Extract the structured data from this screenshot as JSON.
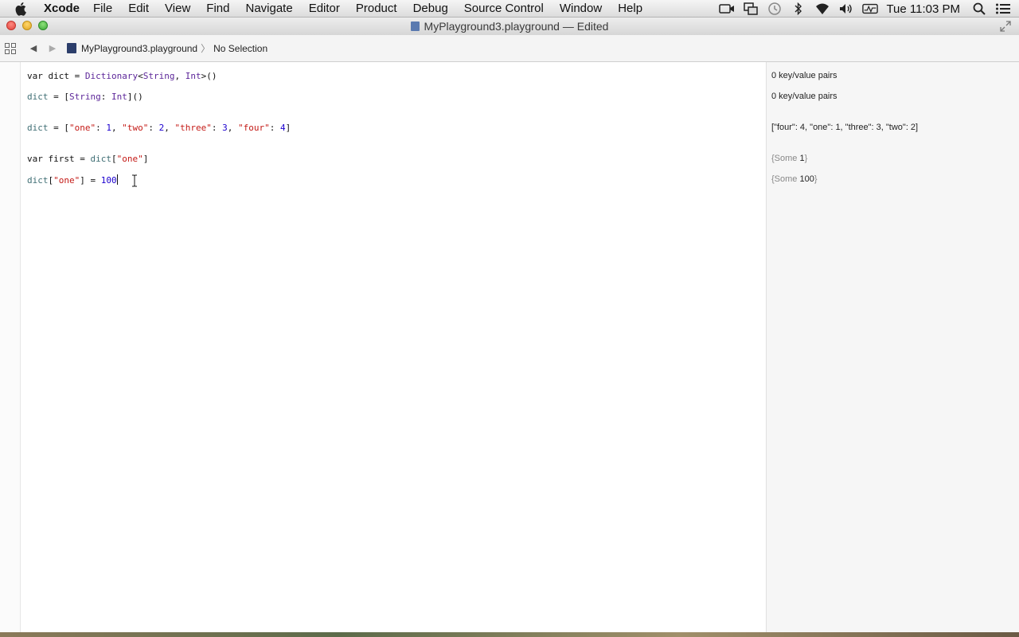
{
  "menubar": {
    "app_name": "Xcode",
    "items": [
      "File",
      "Edit",
      "View",
      "Find",
      "Navigate",
      "Editor",
      "Product",
      "Debug",
      "Source Control",
      "Window",
      "Help"
    ],
    "clock": "Tue 11:03 PM",
    "status_icons": [
      "facetime-camera-icon",
      "mirroring-icon",
      "time-machine-icon",
      "bluetooth-icon",
      "wifi-icon",
      "volume-icon",
      "activity-icon",
      "spotlight-icon",
      "notification-center-icon"
    ]
  },
  "window": {
    "title": "MyPlayground3.playground — Edited"
  },
  "jumpbar": {
    "file": "MyPlayground3.playground",
    "selection": "No Selection"
  },
  "code": {
    "line1": {
      "kw": "var",
      "name": " dict = ",
      "type1": "Dictionary",
      "lt": "<",
      "type2": "String",
      "comma": ", ",
      "type3": "Int",
      "end": ">()"
    },
    "line2": {
      "name": "dict",
      "eq": " = [",
      "type1": "String",
      "colon": ": ",
      "type2": "Int",
      "end": "]()"
    },
    "line3": {
      "name": "dict",
      "eq": " = [",
      "s1": "\"one\"",
      "c1": ": ",
      "n1": "1",
      "sep1": ", ",
      "s2": "\"two\"",
      "c2": ": ",
      "n2": "2",
      "sep2": ", ",
      "s3": "\"three\"",
      "c3": ": ",
      "n3": "3",
      "sep3": ", ",
      "s4": "\"four\"",
      "c4": ": ",
      "n4": "4",
      "end": "]"
    },
    "line4": {
      "kw": "var",
      "name": " first = ",
      "ref": "dict",
      "open": "[",
      "s1": "\"one\"",
      "close": "]"
    },
    "line5": {
      "ref": "dict",
      "open": "[",
      "s1": "\"one\"",
      "close": "] = ",
      "n1": "100"
    }
  },
  "results": {
    "r1": "0 key/value pairs",
    "r2": "0 key/value pairs",
    "r3": "[\"four\": 4, \"one\": 1, \"three\": 3, \"two\": 2]",
    "r4_prefix": "{Some ",
    "r4_value": "1",
    "r4_suffix": "}",
    "r5_prefix": "{Some ",
    "r5_value": "100",
    "r5_suffix": "}"
  }
}
